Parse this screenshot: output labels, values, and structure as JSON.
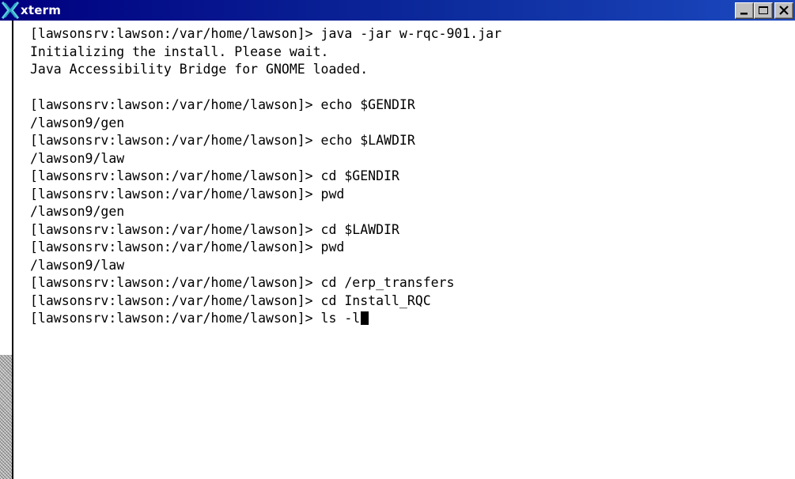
{
  "window": {
    "title": "xterm",
    "icon": "xterm-x-icon",
    "controls": [
      "minimize",
      "maximize",
      "close"
    ]
  },
  "terminal": {
    "lines": [
      "[lawsonsrv:lawson:/var/home/lawson]> java -jar w-rqc-901.jar",
      "Initializing the install. Please wait.",
      "Java Accessibility Bridge for GNOME loaded.",
      "",
      "[lawsonsrv:lawson:/var/home/lawson]> echo $GENDIR",
      "/lawson9/gen",
      "[lawsonsrv:lawson:/var/home/lawson]> echo $LAWDIR",
      "/lawson9/law",
      "[lawsonsrv:lawson:/var/home/lawson]> cd $GENDIR",
      "[lawsonsrv:lawson:/var/home/lawson]> pwd",
      "/lawson9/gen",
      "[lawsonsrv:lawson:/var/home/lawson]> cd $LAWDIR",
      "[lawsonsrv:lawson:/var/home/lawson]> pwd",
      "/lawson9/law",
      "[lawsonsrv:lawson:/var/home/lawson]> cd /erp_transfers",
      "[lawsonsrv:lawson:/var/home/lawson]> cd Install_RQC",
      "[lawsonsrv:lawson:/var/home/lawson]> ls -l"
    ],
    "cursor_line": 16
  },
  "scrollbar": {
    "thumb_start": 0.73,
    "thumb_end": 1.0
  }
}
